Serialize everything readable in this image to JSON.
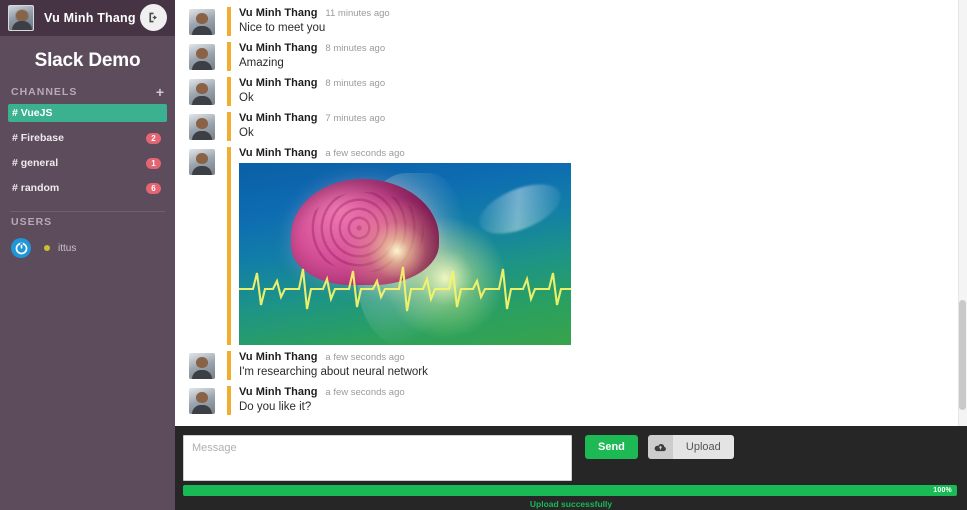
{
  "sidebar": {
    "current_user": "Vu Minh Thang",
    "logout_icon": "sign-out-icon",
    "avatar_icon": "user-avatar",
    "workspace_title": "Slack Demo",
    "channels_label": "CHANNELS",
    "add_channel_icon": "plus-icon",
    "channels": [
      {
        "name": "# VueJS",
        "badge": "",
        "active": true
      },
      {
        "name": "# Firebase",
        "badge": "2",
        "active": false
      },
      {
        "name": "# general",
        "badge": "1",
        "active": false
      },
      {
        "name": "# random",
        "badge": "6",
        "active": false
      }
    ],
    "users_label": "USERS",
    "users": [
      {
        "name": "ittus",
        "status": "away",
        "avatar_icon": "power-icon"
      }
    ]
  },
  "messages": [
    {
      "author": "Vu Minh Thang",
      "time": "11 minutes ago",
      "text": "Nice to meet you",
      "type": "text"
    },
    {
      "author": "Vu Minh Thang",
      "time": "8 minutes ago",
      "text": "Amazing",
      "type": "text"
    },
    {
      "author": "Vu Minh Thang",
      "time": "8 minutes ago",
      "text": "Ok",
      "type": "text"
    },
    {
      "author": "Vu Minh Thang",
      "time": "7 minutes ago",
      "text": "Ok",
      "type": "text"
    },
    {
      "author": "Vu Minh Thang",
      "time": "a few seconds ago",
      "text": "",
      "type": "image",
      "image_alt": "brain with ECG waveform"
    },
    {
      "author": "Vu Minh Thang",
      "time": "a few seconds ago",
      "text": "I'm researching about neural network",
      "type": "text"
    },
    {
      "author": "Vu Minh Thang",
      "time": "a few seconds ago",
      "text": "Do you like it?",
      "type": "text"
    }
  ],
  "composer": {
    "input_value": "",
    "input_placeholder": "Message",
    "send_label": "Send",
    "upload_label": "Upload",
    "upload_icon": "cloud-upload-icon"
  },
  "upload_progress": {
    "percent_label": "100%",
    "percent_value": 100,
    "status_text": "Upload successfully"
  },
  "colors": {
    "sidebar_bg": "#5d4d5c",
    "sidebar_header_bg": "#463344",
    "active_channel": "#3bb190",
    "badge": "#e36572",
    "message_accent": "#f0ad2e",
    "send_green": "#1db954",
    "composer_bg": "#262626"
  }
}
